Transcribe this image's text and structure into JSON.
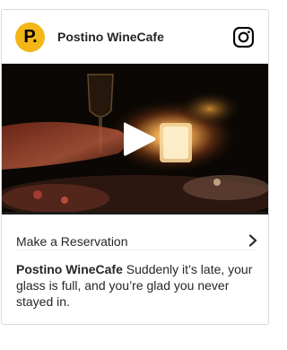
{
  "post": {
    "account_name": "Postino WineCafe",
    "avatar_letter": "P.",
    "avatar_color": "#f2b617",
    "header_icon": "instagram-icon",
    "media": {
      "type": "video",
      "overlay_icon": "play-icon"
    }
  },
  "cta": {
    "label": "Make a Reservation",
    "icon": "chevron-right-icon"
  },
  "caption": {
    "username": "Postino WineCafe",
    "text": "Suddenly it’s late, your glass is full, and you’re glad you never stayed in."
  }
}
